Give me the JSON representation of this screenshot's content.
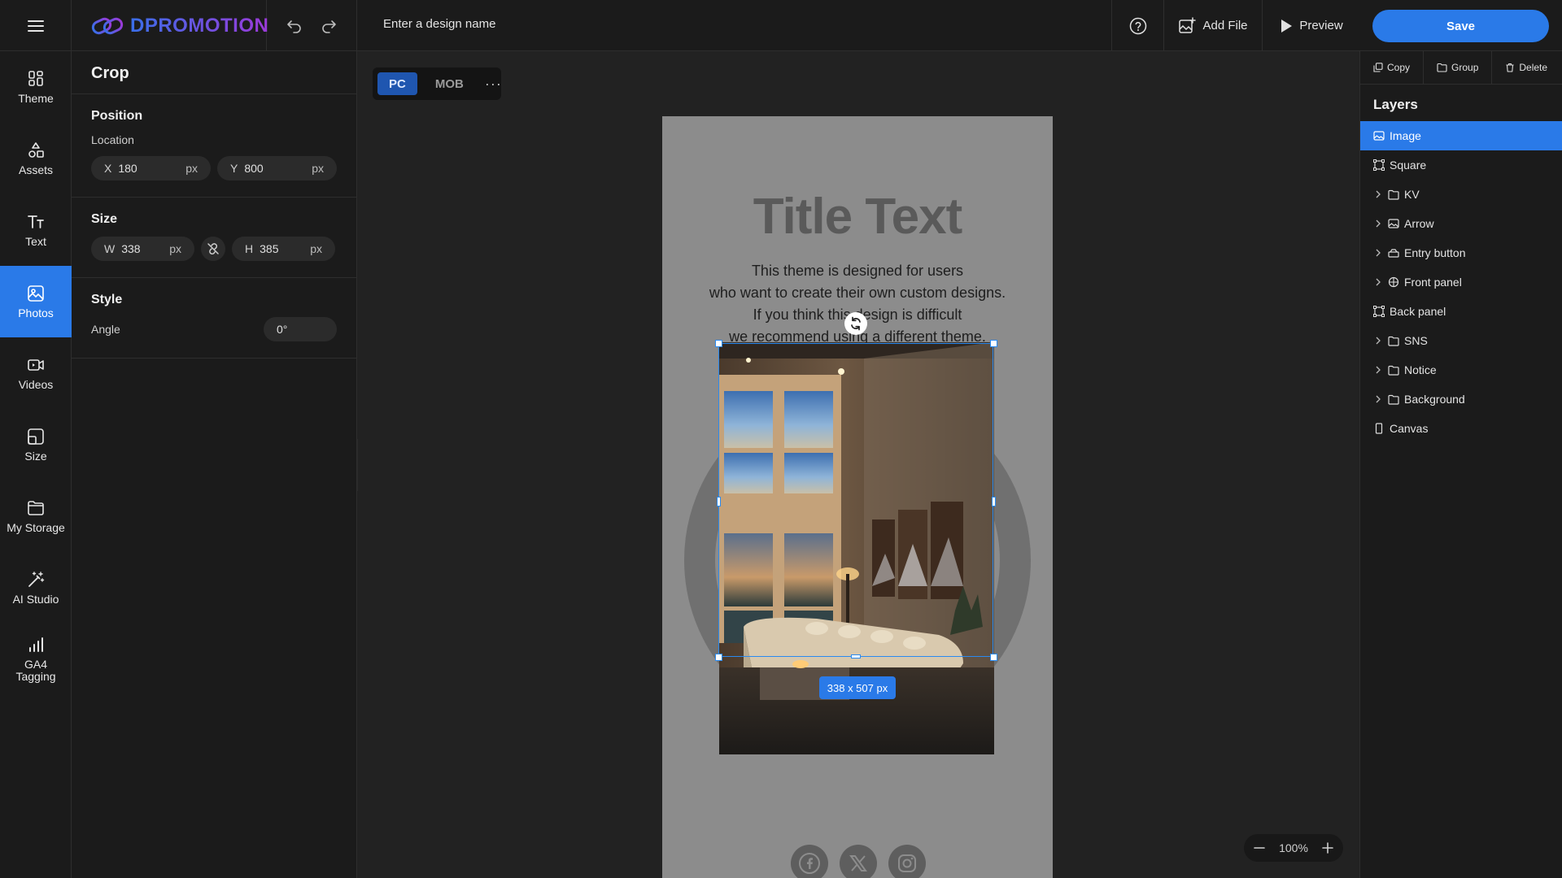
{
  "app": {
    "logo_text": "DPROMOTION",
    "design_name_placeholder": "Enter a design name",
    "add_file_label": "Add File",
    "preview_label": "Preview",
    "save_label": "Save"
  },
  "nav": {
    "items": [
      {
        "label": "Theme",
        "icon": "theme-icon"
      },
      {
        "label": "Assets",
        "icon": "assets-icon"
      },
      {
        "label": "Text",
        "icon": "text-icon"
      },
      {
        "label": "Photos",
        "icon": "photos-icon",
        "active": true
      },
      {
        "label": "Videos",
        "icon": "videos-icon"
      },
      {
        "label": "Size",
        "icon": "size-icon"
      },
      {
        "label": "My Storage",
        "icon": "folder-icon"
      },
      {
        "label": "AI Studio",
        "icon": "magic-wand-icon"
      },
      {
        "label": "GA4\nTagging",
        "icon": "bar-chart-icon"
      }
    ]
  },
  "crop_panel": {
    "title": "Crop",
    "position": {
      "heading": "Position",
      "location_label": "Location",
      "x_label": "X",
      "x_value": "180",
      "y_label": "Y",
      "y_value": "800",
      "unit": "px"
    },
    "size": {
      "heading": "Size",
      "w_label": "W",
      "w_value": "338",
      "h_label": "H",
      "h_value": "385",
      "unit": "px"
    },
    "style": {
      "heading": "Style",
      "angle_label": "Angle",
      "angle_value": "0°"
    }
  },
  "canvas": {
    "device_tabs": [
      "PC",
      "MOB"
    ],
    "active_device": "PC",
    "more_label": "···",
    "title_text": "Title Text",
    "body_lines": [
      "This theme is designed for users",
      "who want to create their own custom designs.",
      "If you think this design is difficult",
      "we recommend using a different theme."
    ],
    "selection_size": "338 x 507 px",
    "zoom": "100%",
    "social_icons": [
      "facebook-icon",
      "x-icon",
      "instagram-icon"
    ]
  },
  "right_panel": {
    "actions": [
      {
        "label": "Copy",
        "icon": "copy-icon"
      },
      {
        "label": "Group",
        "icon": "folder-icon"
      },
      {
        "label": "Delete",
        "icon": "trash-icon"
      }
    ],
    "layers_title": "Layers",
    "layers": [
      {
        "label": "Image",
        "icon": "image-icon",
        "expandable": false,
        "active": true
      },
      {
        "label": "Square",
        "icon": "square-icon",
        "expandable": false
      },
      {
        "label": "KV",
        "icon": "folder-icon",
        "expandable": true
      },
      {
        "label": "Arrow",
        "icon": "image-icon",
        "expandable": true
      },
      {
        "label": "Entry button",
        "icon": "button-icon",
        "expandable": true
      },
      {
        "label": "Front panel",
        "icon": "component-icon",
        "expandable": true
      },
      {
        "label": "Back panel",
        "icon": "square-icon",
        "expandable": false
      },
      {
        "label": "SNS",
        "icon": "folder-icon",
        "expandable": true
      },
      {
        "label": "Notice",
        "icon": "folder-icon",
        "expandable": true
      },
      {
        "label": "Background",
        "icon": "folder-icon",
        "expandable": true
      },
      {
        "label": "Canvas",
        "icon": "canvas-icon",
        "expandable": false
      }
    ]
  },
  "colors": {
    "accent": "#2a7ae8",
    "background": "#1b1b1b",
    "workspace": "#222222",
    "artboard": "#8c8c8c"
  }
}
